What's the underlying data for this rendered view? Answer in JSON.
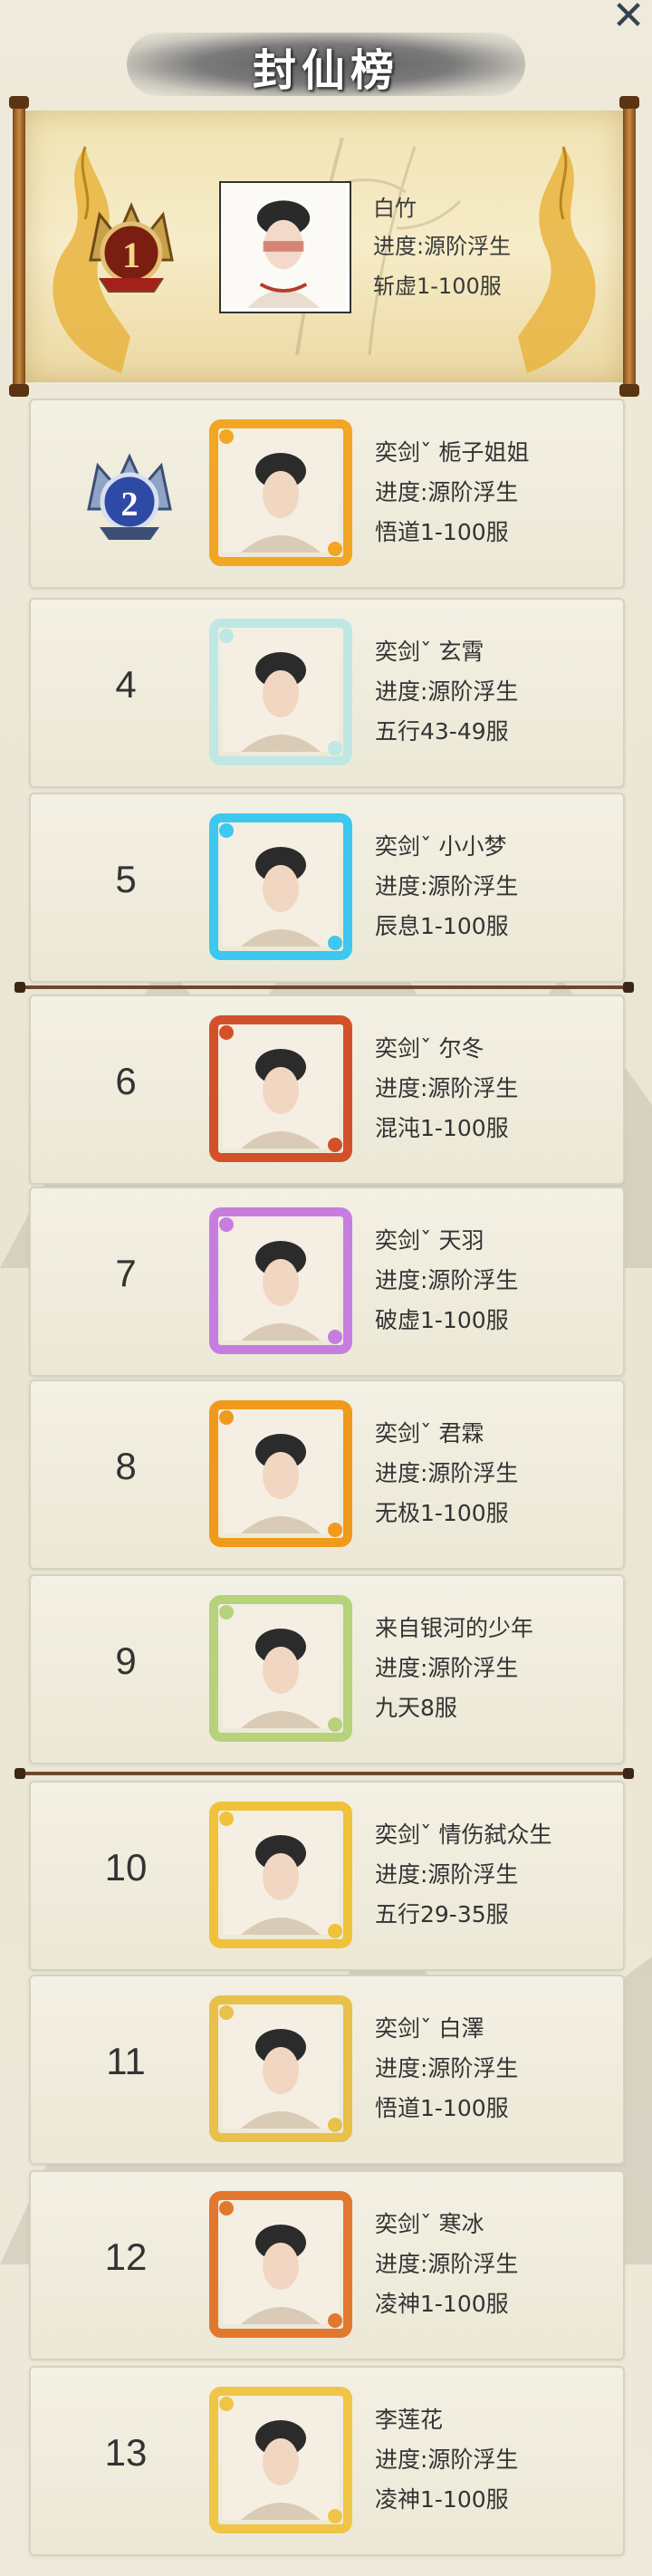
{
  "header": {
    "title": "封仙榜",
    "close_label": "✕"
  },
  "top_entry": {
    "rank": "1",
    "name": "白竹",
    "progress": "进度:源阶浮生",
    "server": "斩虚1-100服"
  },
  "entries": [
    {
      "rank": "2",
      "name": "奕剑ˇ 栀子姐姐",
      "progress": "进度:源阶浮生",
      "server": "悟道1-100服",
      "frame_color": "#f2a623",
      "badge": true
    },
    {
      "rank": "4",
      "name": "奕剑ˇ 玄霄",
      "progress": "进度:源阶浮生",
      "server": "五行43-49服",
      "frame_color": "#bfe7e4",
      "badge": false
    },
    {
      "rank": "5",
      "name": "奕剑ˇ 小小梦",
      "progress": "进度:源阶浮生",
      "server": "辰息1-100服",
      "frame_color": "#3cc8f0",
      "badge": false
    },
    {
      "rank": "6",
      "name": "奕剑ˇ 尔冬",
      "progress": "进度:源阶浮生",
      "server": "混沌1-100服",
      "frame_color": "#d2512a",
      "badge": false
    },
    {
      "rank": "7",
      "name": "奕剑ˇ 天羽",
      "progress": "进度:源阶浮生",
      "server": "破虚1-100服",
      "frame_color": "#c77de0",
      "badge": false
    },
    {
      "rank": "8",
      "name": "奕剑ˇ 君霖",
      "progress": "进度:源阶浮生",
      "server": "无极1-100服",
      "frame_color": "#f09a1c",
      "badge": false
    },
    {
      "rank": "9",
      "name": "来自银河的少年",
      "progress": "进度:源阶浮生",
      "server": "九天8服",
      "frame_color": "#b6d27a",
      "badge": false
    },
    {
      "rank": "10",
      "name": "奕剑ˇ 情伤弑众生",
      "progress": "进度:源阶浮生",
      "server": "五行29-35服",
      "frame_color": "#f0c23a",
      "badge": false
    },
    {
      "rank": "11",
      "name": "奕剑ˇ 白澤",
      "progress": "进度:源阶浮生",
      "server": "悟道1-100服",
      "frame_color": "#e9c04a",
      "badge": false
    },
    {
      "rank": "12",
      "name": "奕剑ˇ 寒冰",
      "progress": "进度:源阶浮生",
      "server": "凌神1-100服",
      "frame_color": "#e2782e",
      "badge": false
    },
    {
      "rank": "13",
      "name": "李莲花",
      "progress": "进度:源阶浮生",
      "server": "凌神1-100服",
      "frame_color": "#efc545",
      "badge": false
    }
  ],
  "colors": {
    "parchment": "#f3e6bb",
    "row_bg": "#f0ede0",
    "text": "#333333",
    "gold": "#e8b53a"
  },
  "icons": {
    "rank_1": "gold-crown-badge",
    "rank_2": "silver-crown-badge",
    "close": "close-icon"
  }
}
